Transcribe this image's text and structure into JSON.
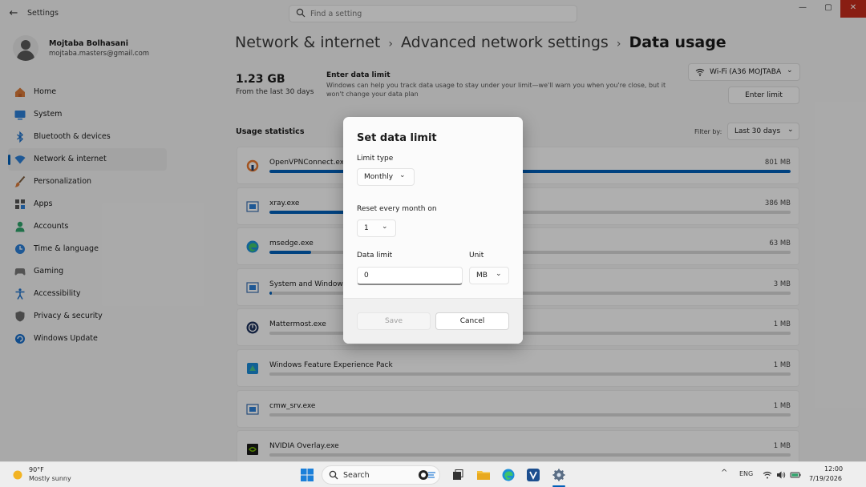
{
  "window": {
    "title": "Settings",
    "back_glyph": "←",
    "search_placeholder": "Find a setting",
    "min_glyph": "—",
    "max_glyph": "▢",
    "close_glyph": "✕"
  },
  "user": {
    "name": "Mojtaba Bolhasani",
    "email": "mojtaba.masters@gmail.com"
  },
  "nav": [
    {
      "label": "Home",
      "icon": "home-icon"
    },
    {
      "label": "System",
      "icon": "system-icon"
    },
    {
      "label": "Bluetooth & devices",
      "icon": "bluetooth-icon"
    },
    {
      "label": "Network & internet",
      "icon": "network-icon",
      "active": true
    },
    {
      "label": "Personalization",
      "icon": "brush-icon"
    },
    {
      "label": "Apps",
      "icon": "apps-icon"
    },
    {
      "label": "Accounts",
      "icon": "accounts-icon"
    },
    {
      "label": "Time & language",
      "icon": "time-language-icon"
    },
    {
      "label": "Gaming",
      "icon": "gaming-icon"
    },
    {
      "label": "Accessibility",
      "icon": "accessibility-icon"
    },
    {
      "label": "Privacy & security",
      "icon": "shield-icon"
    },
    {
      "label": "Windows Update",
      "icon": "update-icon"
    }
  ],
  "breadcrumb": {
    "part1": "Network & internet",
    "part2": "Advanced network settings",
    "current": "Data usage",
    "sep": "›"
  },
  "summary": {
    "total": "1.23 GB",
    "period": "From the last 30 days",
    "limit_title": "Enter data limit",
    "limit_desc": "Windows can help you track data usage to stay under your limit—we'll warn you when you're close, but it won't change your data plan"
  },
  "network_select": {
    "value": "Wi-Fi (A36 MOJTABA"
  },
  "enter_limit_label": "Enter limit",
  "usage": {
    "title": "Usage statistics",
    "filter_label": "Filter by:",
    "filter_value": "Last 30 days"
  },
  "apps": [
    {
      "name": "OpenVPNConnect.exe",
      "size": "801 MB",
      "fraction": 1.0,
      "icon": "openvpn-icon"
    },
    {
      "name": "xray.exe",
      "size": "386 MB",
      "fraction": 0.48,
      "icon": "app-window-icon"
    },
    {
      "name": "msedge.exe",
      "size": "63 MB",
      "fraction": 0.08,
      "icon": "edge-icon"
    },
    {
      "name": "System and Windows",
      "size": "3 MB",
      "fraction": 0.005,
      "icon": "system-window-icon"
    },
    {
      "name": "Mattermost.exe",
      "size": "1 MB",
      "fraction": 0.0,
      "icon": "mattermost-icon"
    },
    {
      "name": "Windows Feature Experience Pack",
      "size": "1 MB",
      "fraction": 0.0,
      "icon": "feature-pack-icon"
    },
    {
      "name": "cmw_srv.exe",
      "size": "1 MB",
      "fraction": 0.0,
      "icon": "app-window-icon"
    },
    {
      "name": "NVIDIA Overlay.exe",
      "size": "1 MB",
      "fraction": 0.0,
      "icon": "nvidia-icon"
    }
  ],
  "dialog": {
    "title": "Set data limit",
    "limit_type_label": "Limit type",
    "limit_type_value": "Monthly",
    "reset_label": "Reset every month on",
    "reset_value": "1",
    "data_limit_label": "Data limit",
    "data_limit_value": "0",
    "unit_label": "Unit",
    "unit_value": "MB",
    "save_label": "Save",
    "cancel_label": "Cancel"
  },
  "taskbar": {
    "temp": "90°F",
    "condition": "Mostly sunny",
    "search_label": "Search",
    "lang": "ENG",
    "time": "12:00",
    "date": "7/19/2026"
  },
  "colors": {
    "accent": "#005fb8",
    "close": "#c42b1c"
  }
}
